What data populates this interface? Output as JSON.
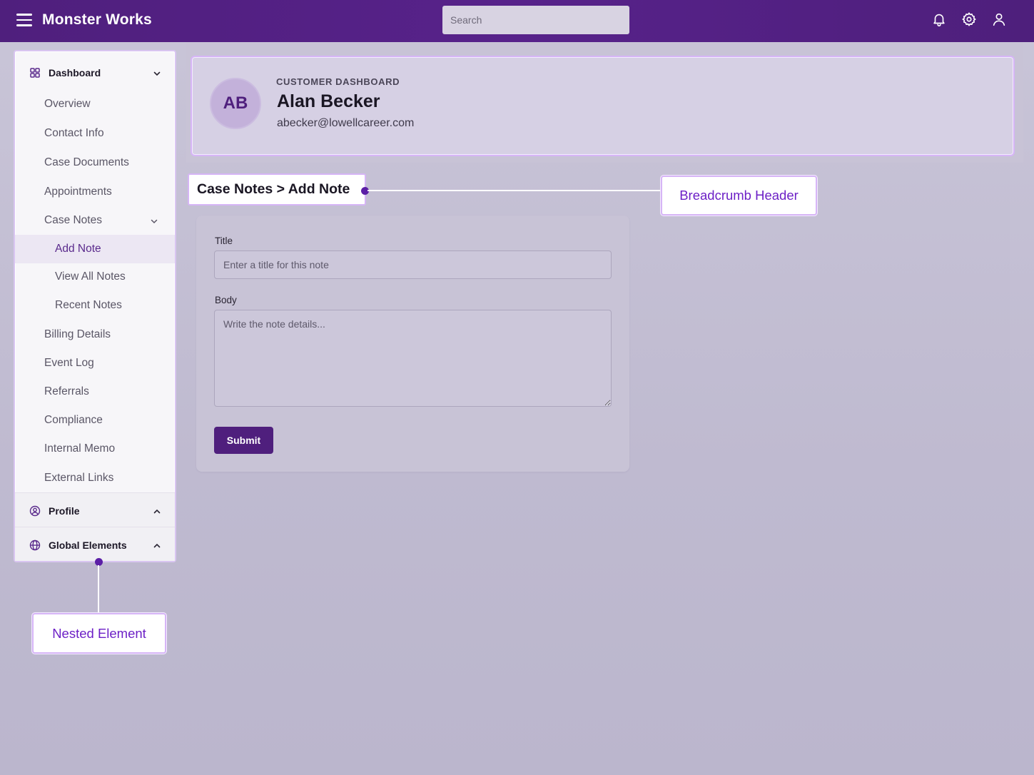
{
  "app": {
    "title": "Monster Works",
    "brand_color": "#4f1f7d"
  },
  "search": {
    "placeholder": "Search"
  },
  "topbar_icons": [
    "bell-icon",
    "gear-icon",
    "user-icon"
  ],
  "sidebar": {
    "dashboard": {
      "label": "Dashboard",
      "items": [
        {
          "label": "Overview"
        },
        {
          "label": "Contact Info"
        },
        {
          "label": "Case Documents"
        },
        {
          "label": "Appointments"
        },
        {
          "label": "Case Notes"
        }
      ],
      "case_notes_sub": [
        {
          "label": "Add Note",
          "active": true
        },
        {
          "label": "View All Notes"
        },
        {
          "label": "Recent Notes"
        }
      ],
      "items_after": [
        {
          "label": "Billing Details"
        },
        {
          "label": "Event Log"
        },
        {
          "label": "Referrals"
        },
        {
          "label": "Compliance"
        },
        {
          "label": "Internal Memo"
        },
        {
          "label": "External Links"
        }
      ]
    },
    "profile": {
      "label": "Profile"
    },
    "global": {
      "label": "Global Elements"
    }
  },
  "customer": {
    "initials": "AB",
    "label": "CUSTOMER DASHBOARD",
    "name": "Alan Becker",
    "email": "abecker@lowellcareer.com"
  },
  "breadcrumb": {
    "text": "Case Notes > Add Note"
  },
  "form": {
    "title_label": "Title",
    "title_placeholder": "Enter a title for this note",
    "body_label": "Body",
    "body_placeholder": "Write the note details...",
    "submit_label": "Submit"
  },
  "callouts": {
    "breadcrumb_header": "Breadcrumb Header",
    "nested_element": "Nested Element"
  }
}
